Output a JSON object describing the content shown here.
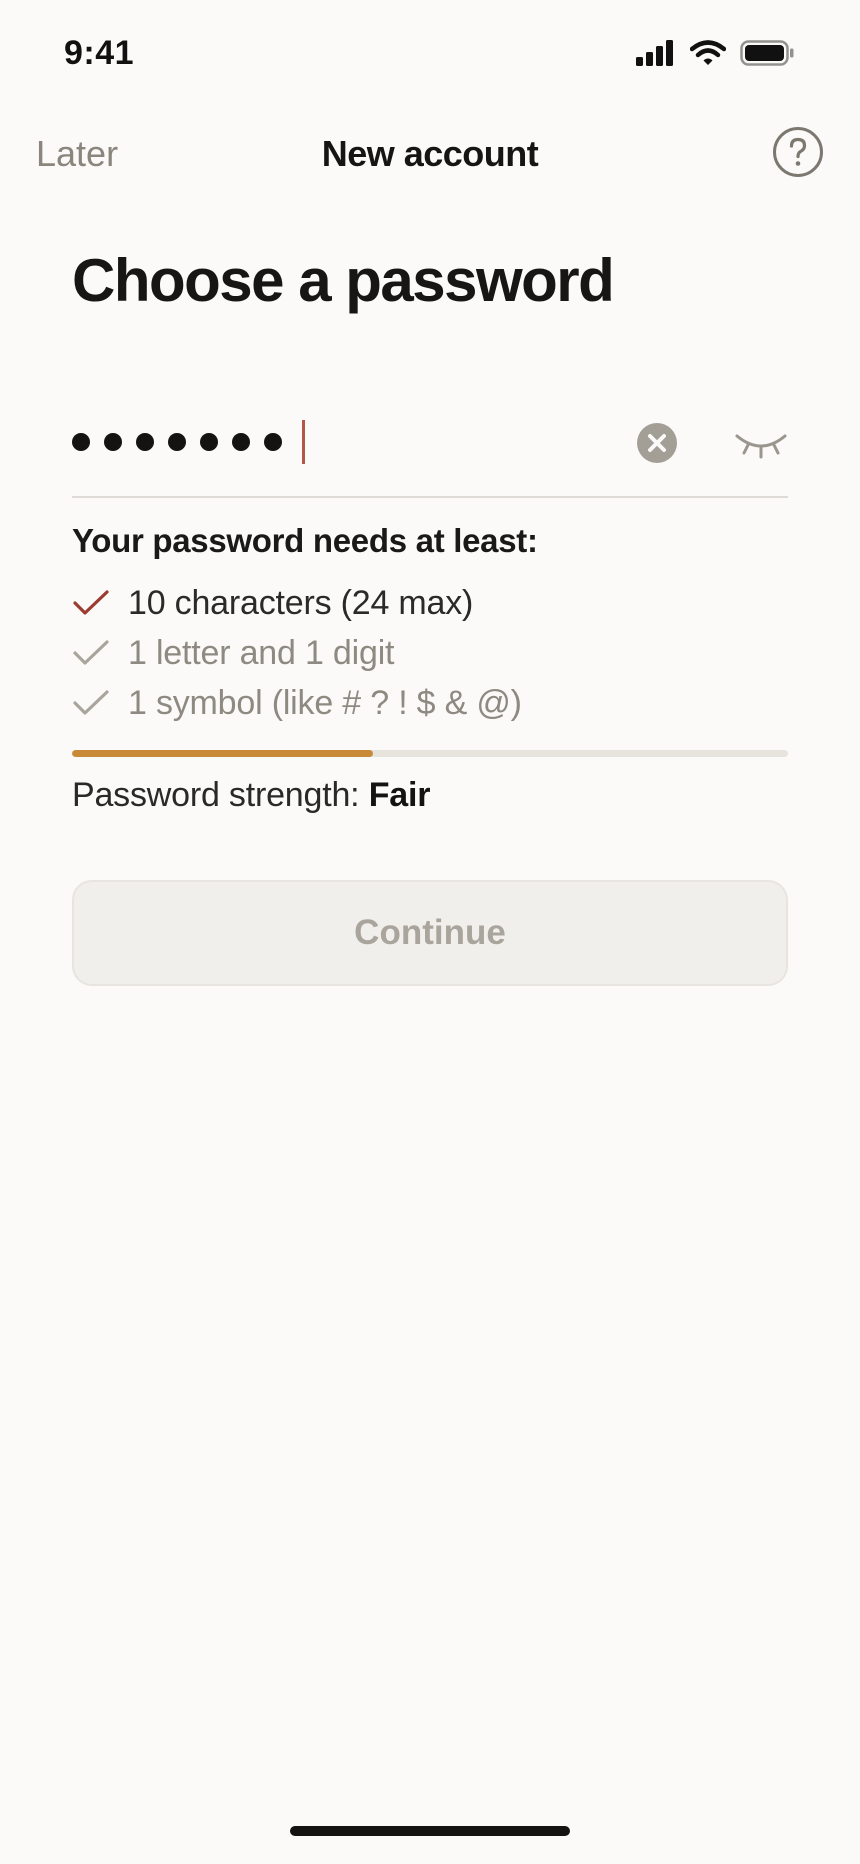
{
  "status_bar": {
    "time": "9:41"
  },
  "nav": {
    "left_label": "Later",
    "title": "New account",
    "help_icon": "question-circle-icon"
  },
  "page": {
    "heading": "Choose a password"
  },
  "password_field": {
    "masked_length": 7,
    "clear_icon": "clear-circle-icon",
    "reveal_icon": "eye-closed-icon"
  },
  "requirements": {
    "heading": "Your password needs at least:",
    "items": [
      {
        "label": "10 characters (24 max)",
        "met": true
      },
      {
        "label": "1 letter and 1 digit",
        "met": false
      },
      {
        "label": "1 symbol (like # ? ! $ & @)",
        "met": false
      }
    ]
  },
  "strength": {
    "label": "Password strength:",
    "value": "Fair",
    "level": 0.42
  },
  "actions": {
    "continue_label": "Continue",
    "continue_enabled": false
  },
  "colors": {
    "background": "#fbfaf8",
    "check_met": "#9c3b30",
    "check_unmet": "#a9a59d",
    "strength_fill": "#c98a37",
    "caret": "#b5564a"
  }
}
